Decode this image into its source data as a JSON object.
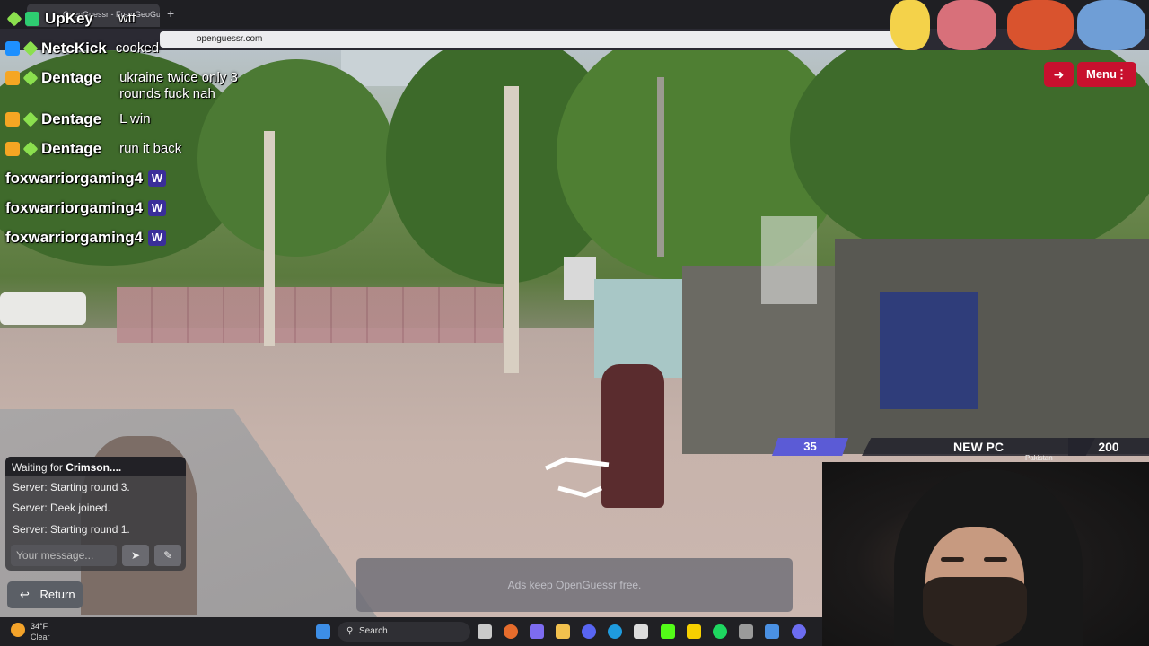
{
  "browser": {
    "tab_title": "OpenGuessr - Free GeoGuessr",
    "new_tab": "+",
    "url": "openguessr.com"
  },
  "stream_chat": [
    {
      "user": "UpKey",
      "message": "wtf",
      "badge_color": "#2ecc71"
    },
    {
      "user": "NetcKick",
      "message": "cooked",
      "badge_color": "#1e90ff"
    },
    {
      "user": "Dentage",
      "message": "ukraine twice only 3 rounds fuck nah",
      "badge_color": "#f5a623"
    },
    {
      "user": "Dentage",
      "message": "L win",
      "badge_color": "#f5a623"
    },
    {
      "user": "Dentage",
      "message": "run it back",
      "badge_color": "#f5a623"
    },
    {
      "user": "foxwarriorgaming4",
      "message": "",
      "emote": "W"
    },
    {
      "user": "foxwarriorgaming4",
      "message": "",
      "emote": "W"
    },
    {
      "user": "foxwarriorgaming4",
      "message": "",
      "emote": "W"
    }
  ],
  "game": {
    "menu_label": "Menu",
    "exit_icon": "exit-icon",
    "score_left": "35",
    "center_label": "NEW PC",
    "score_right": "200",
    "minimap_label": "Pakistan",
    "chat": {
      "waiting_prefix": "Waiting for",
      "waiting_name": "Crimson....",
      "messages": [
        "Server: Starting round 3.",
        "Server: Deek joined.",
        "Server: Starting round 1."
      ],
      "input_placeholder": "Your message...",
      "send_icon": "send-icon",
      "report_icon": "report-icon"
    },
    "return_label": "Return",
    "ad_text": "Ads keep OpenGuessr free.",
    "accent_color": "#c8102e",
    "score_color": "#5b5bd6"
  },
  "taskbar": {
    "temperature": "34°F",
    "condition": "Clear",
    "search_label": "Search"
  }
}
